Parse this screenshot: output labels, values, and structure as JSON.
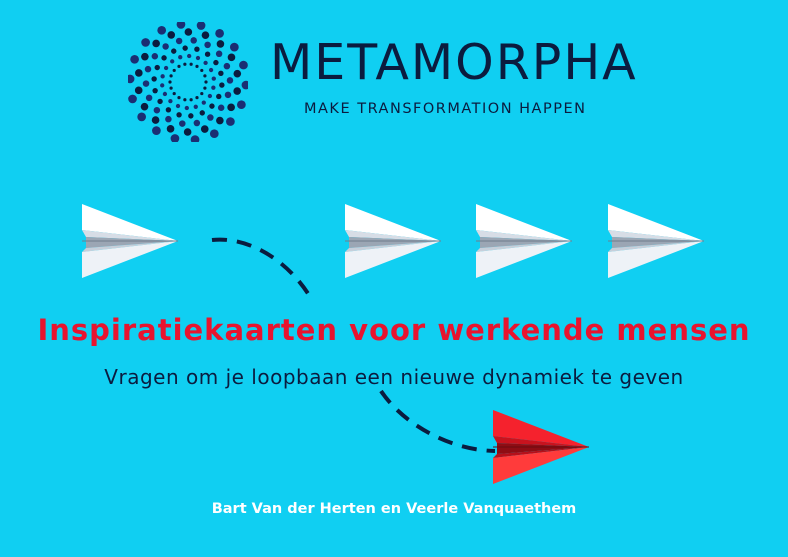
{
  "brand": {
    "name": "METAMORPHA",
    "tagline": "MAKE TRANSFORMATION HAPPEN",
    "logo_icon": "spiral-dots-icon"
  },
  "cover": {
    "title": "Inspiratiekaarten voor werkende mensen",
    "subtitle": "Vragen om je loopbaan een nieuwe dynamiek te geven",
    "authors": "Bart Van der Herten en Veerle Vanquaethem"
  },
  "illustration": {
    "icon": "paper-plane-icon",
    "white_planes": 4,
    "red_planes": 1
  },
  "colors": {
    "background": "#10CFF2",
    "navy": "#0B1C3F",
    "accent_red": "#E8142E",
    "plane_white": "#FFFFFF"
  }
}
